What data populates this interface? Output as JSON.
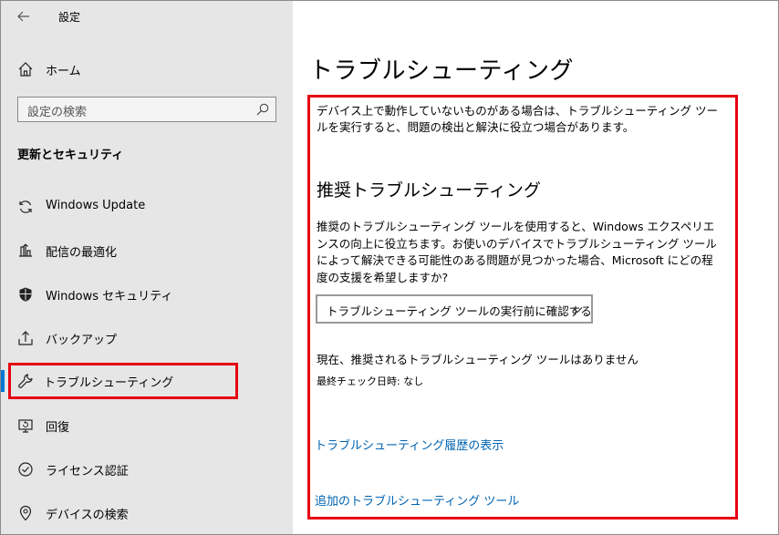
{
  "app": {
    "title": "設定",
    "back_label": "←"
  },
  "sidebar": {
    "home_label": "ホーム",
    "search_placeholder": "設定の検索",
    "section_title": "更新とセキュリティ",
    "items": [
      {
        "label": "Windows Update",
        "icon": "refresh-icon"
      },
      {
        "label": "配信の最適化",
        "icon": "delivery-optimization-icon"
      },
      {
        "label": "Windows セキュリティ",
        "icon": "shield-icon"
      },
      {
        "label": "バックアップ",
        "icon": "backup-icon"
      },
      {
        "label": "トラブルシューティング",
        "icon": "wrench-icon",
        "selected": true
      },
      {
        "label": "回復",
        "icon": "recovery-icon"
      },
      {
        "label": "ライセンス認証",
        "icon": "activation-icon"
      },
      {
        "label": "デバイスの検索",
        "icon": "find-device-icon"
      }
    ]
  },
  "main": {
    "title": "トラブルシューティング",
    "description": "デバイス上で動作していないものがある場合は、トラブルシューティング ツールを実行すると、問題の検出と解決に役立つ場合があります。",
    "recommended_title": "推奨トラブルシューティング",
    "recommended_text": "推奨のトラブルシューティング ツールを使用すると、Windows エクスペリエンスの向上に役立ちます。お使いのデバイスでトラブルシューティング ツールによって解決できる可能性のある問題が見つかった場合、Microsoft にどの程度の支援を希望しますか?",
    "dropdown_value": "トラブルシューティング ツールの実行前に確認する",
    "status_text": "現在、推奨されるトラブルシューティング ツールはありません",
    "last_check": "最終チェック日時: なし",
    "history_link": "トラブルシューティング履歴の表示",
    "additional_link": "追加のトラブルシューティング ツール"
  },
  "colors": {
    "accent": "#0078d7",
    "link": "#0063b1",
    "highlight": "#e60012",
    "sidebar_bg": "#e6e6e6"
  }
}
